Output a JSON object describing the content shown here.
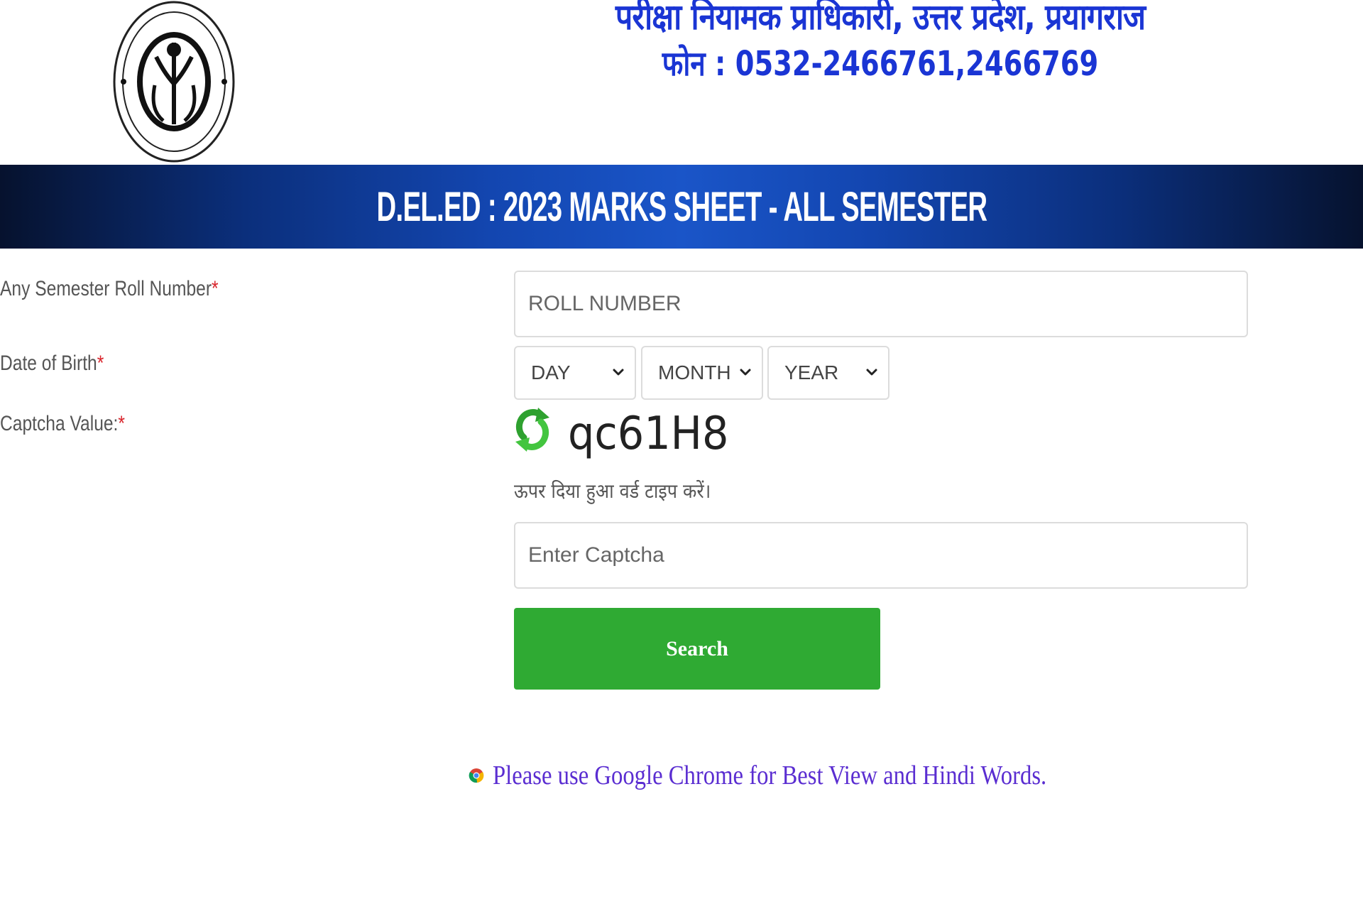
{
  "header": {
    "logo_icon": "up-government-seal-logo",
    "org_title": "परीक्षा नियामक प्राधिकारी, उत्तर प्रदेश, प्रयागराज",
    "phone_line": "फोन : 0532-2466761,2466769"
  },
  "banner": {
    "title": "D.EL.ED : 2023 MARKS SHEET - ALL SEMESTER"
  },
  "form": {
    "roll": {
      "label": "Any Semester Roll Number",
      "required_mark": "*",
      "placeholder": "ROLL NUMBER",
      "value": ""
    },
    "dob": {
      "label": "Date of Birth",
      "required_mark": "*",
      "day": "DAY",
      "month": "MONTH",
      "year": "YEAR"
    },
    "captcha": {
      "label": "Captcha Value:",
      "required_mark": "*",
      "refresh_icon": "refresh-icon",
      "code": "qc61H8",
      "hint": "ऊपर दिया हुआ वर्ड टाइप करें।",
      "placeholder": "Enter Captcha",
      "value": ""
    },
    "search_label": "Search"
  },
  "footer": {
    "browser_icon": "chrome-icon",
    "notice": "Please use Google Chrome for Best View and Hindi Words."
  },
  "colors": {
    "header_text": "#1a35d4",
    "banner_dark": "#06122e",
    "banner_mid": "#1a55c8",
    "required": "#d9242b",
    "button": "#2faa33",
    "notice_text": "#5a2dd1"
  }
}
